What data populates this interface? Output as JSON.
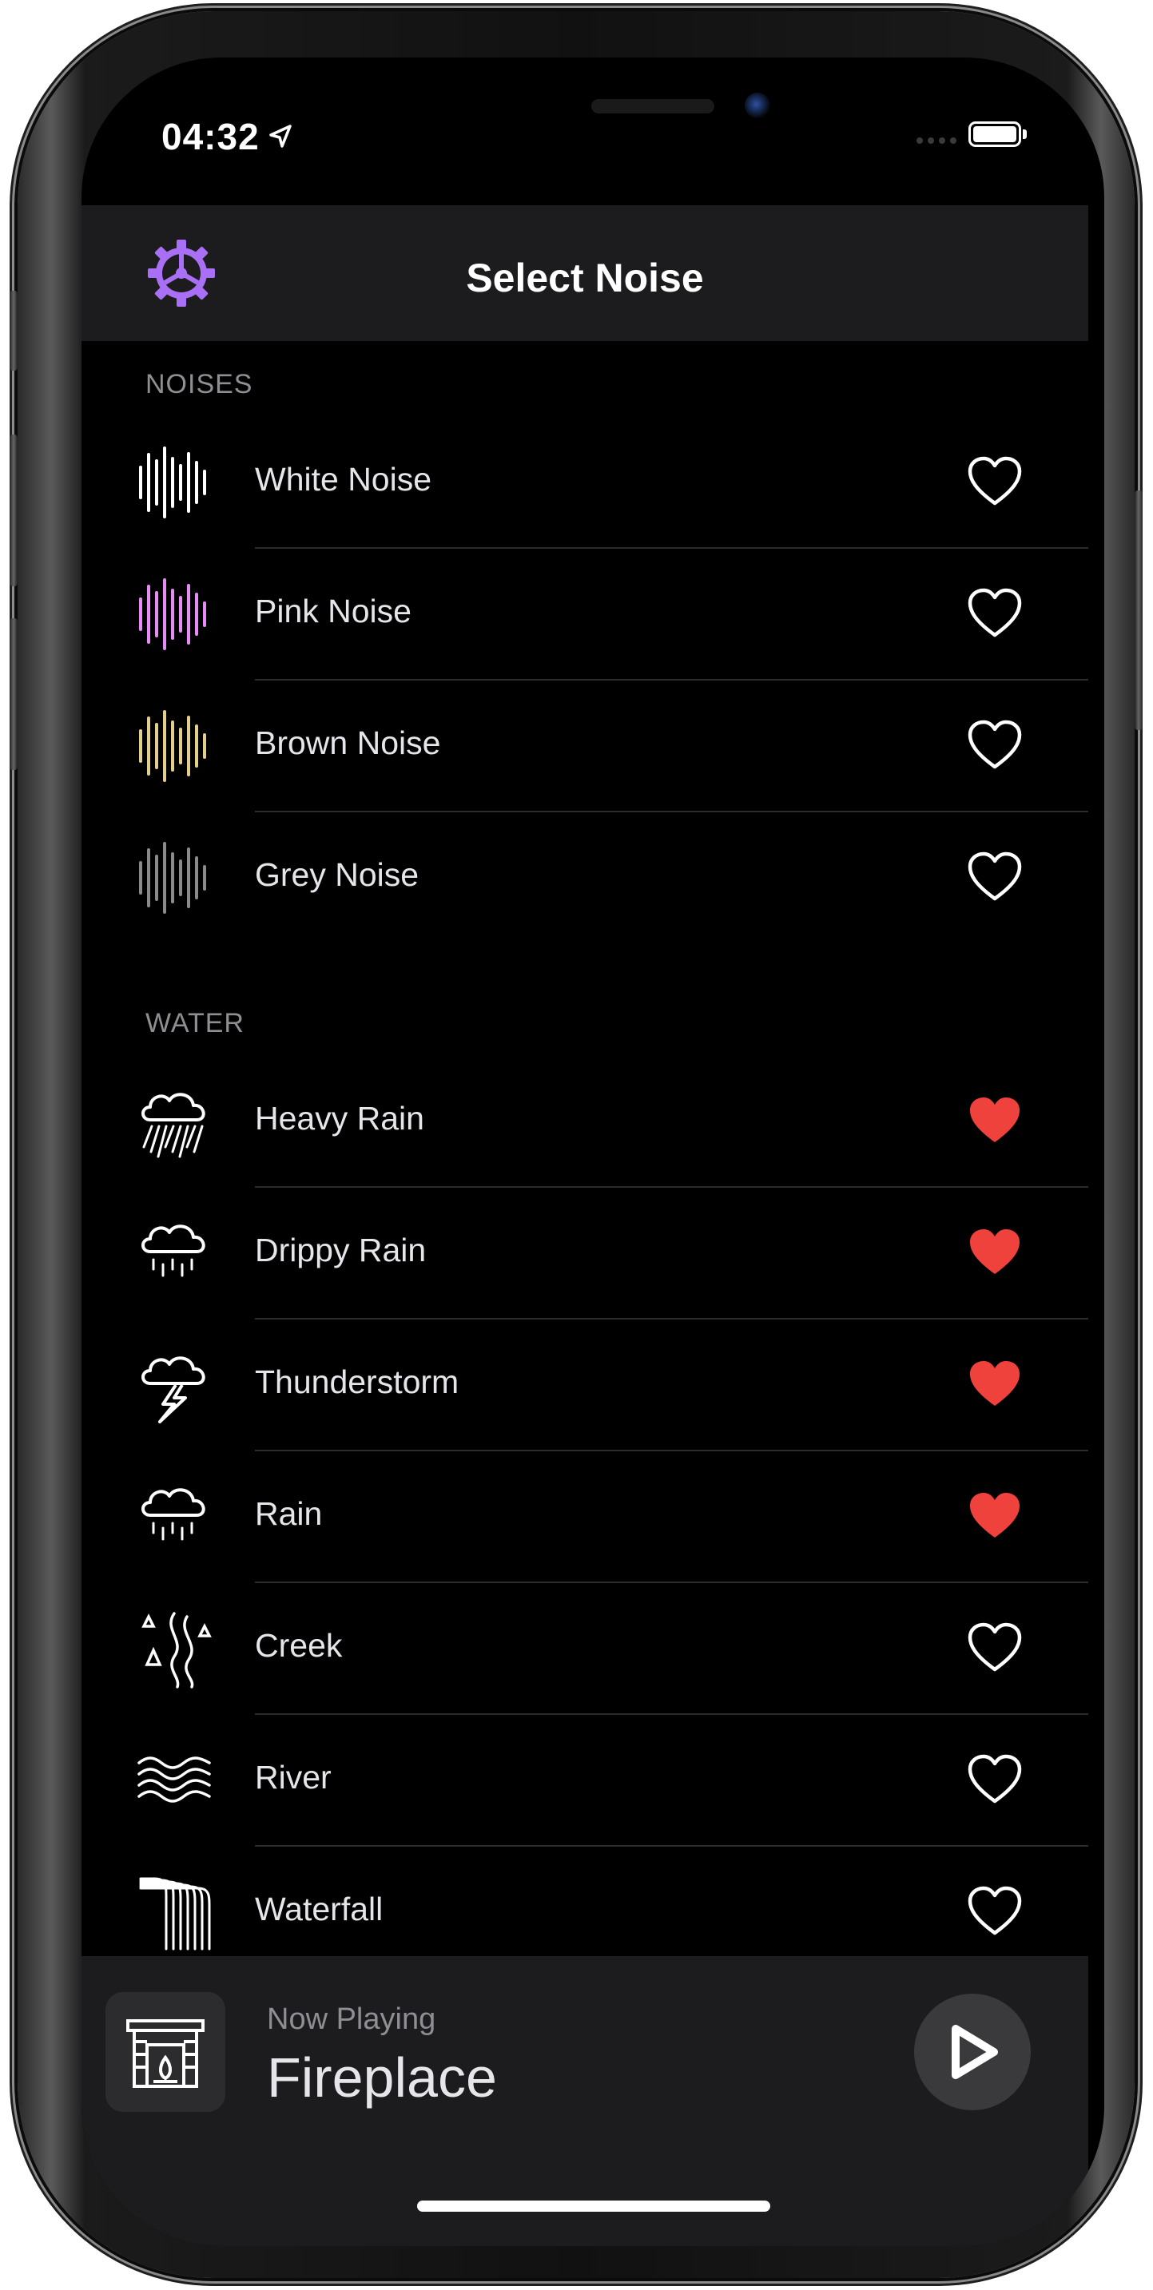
{
  "status_bar": {
    "time": "04:32",
    "location_icon": "location-arrow-icon",
    "battery_icon": "battery-icon"
  },
  "nav": {
    "title": "Select Noise",
    "settings_icon": "gear-icon",
    "accent": "#a970f5"
  },
  "sections": [
    {
      "header": "NOISES",
      "items": [
        {
          "label": "White Noise",
          "icon": "waveform-icon",
          "icon_color": "#ffffff",
          "favorite": false
        },
        {
          "label": "Pink Noise",
          "icon": "waveform-icon",
          "icon_color": "#e88cf5",
          "favorite": false
        },
        {
          "label": "Brown Noise",
          "icon": "waveform-icon",
          "icon_color": "#e3cf8c",
          "favorite": false
        },
        {
          "label": "Grey Noise",
          "icon": "waveform-icon",
          "icon_color": "#8a8a8a",
          "favorite": false
        }
      ]
    },
    {
      "header": "WATER",
      "items": [
        {
          "label": "Heavy Rain",
          "icon": "heavy-rain-icon",
          "favorite": true
        },
        {
          "label": "Drippy Rain",
          "icon": "drippy-rain-icon",
          "favorite": true
        },
        {
          "label": "Thunderstorm",
          "icon": "thunderstorm-icon",
          "favorite": true
        },
        {
          "label": "Rain",
          "icon": "rain-icon",
          "favorite": true
        },
        {
          "label": "Creek",
          "icon": "creek-icon",
          "favorite": false
        },
        {
          "label": "River",
          "icon": "river-icon",
          "favorite": false
        },
        {
          "label": "Waterfall",
          "icon": "waterfall-icon",
          "favorite": false
        }
      ]
    }
  ],
  "favorite_color": "#f0423c",
  "player": {
    "now_label": "Now Playing",
    "title": "Fireplace",
    "artwork_icon": "fireplace-icon",
    "play_icon": "play-icon"
  }
}
